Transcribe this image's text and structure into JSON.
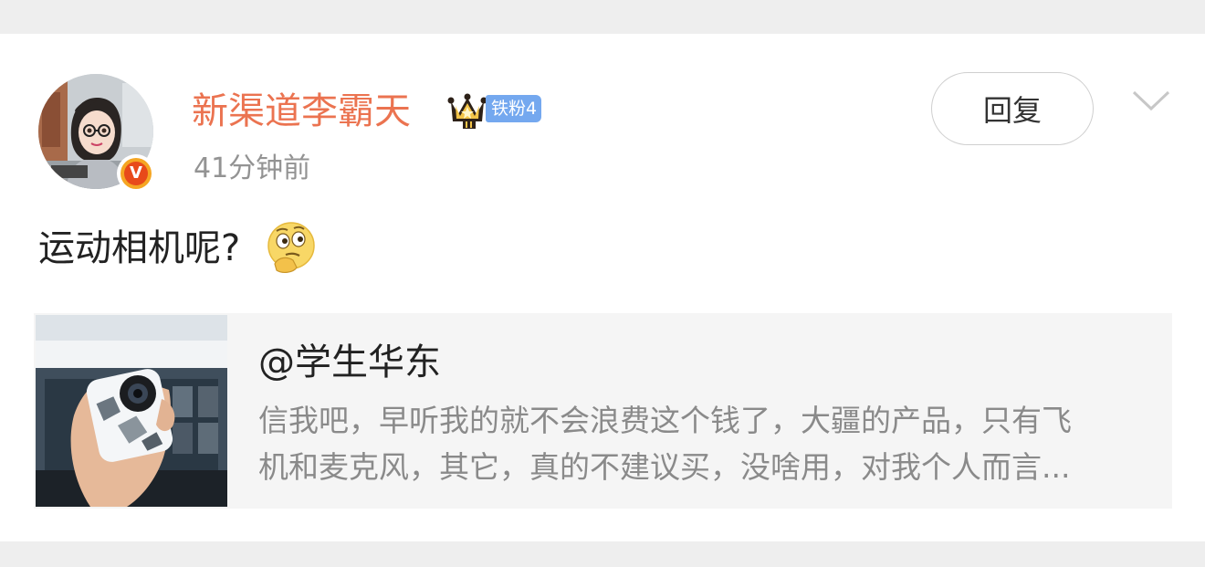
{
  "post": {
    "username": "新渠道李霸天",
    "fan_badge": "铁粉4",
    "timestamp": "41分钟前",
    "reply_label": "回复",
    "comment_text": "运动相机呢?",
    "verified_mark": "V"
  },
  "quote": {
    "author": "@学生华东",
    "line1": "信我吧，早听我的就不会浪费这个钱了，大疆的产品，只有飞",
    "line2": "机和麦克风，其它，真的不建议买，没啥用，对我个人而言..."
  },
  "colors": {
    "username": "#eb7350",
    "fan_badge_bg": "#74a8ef",
    "timestamp": "#939393",
    "page_bg": "#eeeeee"
  },
  "icons": {
    "avatar": "user-avatar",
    "verified": "verified-v-badge",
    "crown": "crown-icon",
    "more": "chevron-down-icon",
    "emoji": "thinking-face-emoji"
  }
}
